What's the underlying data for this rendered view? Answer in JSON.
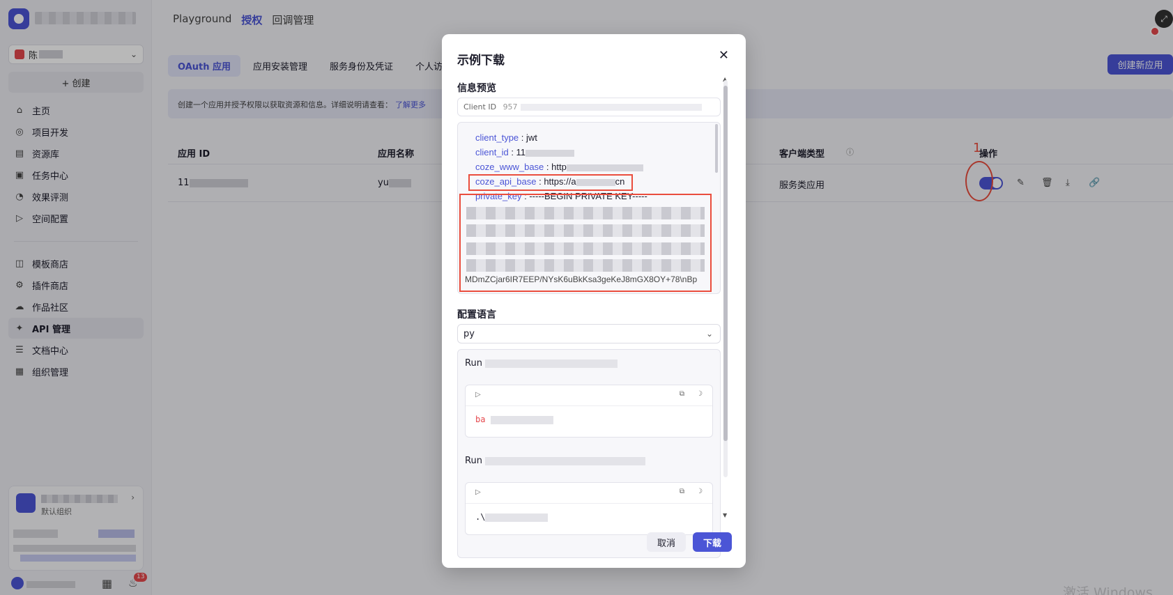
{
  "sidebar": {
    "space_name": "陈",
    "create_label": "+ 创建",
    "items": [
      {
        "icon": "home-icon",
        "glyph": "⌂",
        "label": "主页"
      },
      {
        "icon": "gamepad-icon",
        "glyph": "◎",
        "label": "项目开发"
      },
      {
        "icon": "library-icon",
        "glyph": "▤",
        "label": "资源库"
      },
      {
        "icon": "task-icon",
        "glyph": "▣",
        "label": "任务中心"
      },
      {
        "icon": "gauge-icon",
        "glyph": "◔",
        "label": "效果评测"
      },
      {
        "icon": "terminal-icon",
        "glyph": "▷",
        "label": "空间配置"
      }
    ],
    "items2": [
      {
        "icon": "template-icon",
        "glyph": "◫",
        "label": "模板商店"
      },
      {
        "icon": "plugin-icon",
        "glyph": "⚙",
        "label": "插件商店"
      },
      {
        "icon": "community-icon",
        "glyph": "☁",
        "label": "作品社区"
      },
      {
        "icon": "api-icon",
        "glyph": "✦",
        "label": "API 管理"
      },
      {
        "icon": "doc-icon",
        "glyph": "☰",
        "label": "文档中心"
      },
      {
        "icon": "org-icon",
        "glyph": "▦",
        "label": "组织管理"
      }
    ],
    "org_sub": "默认组织",
    "notification_count": "13"
  },
  "header": {
    "tabs": [
      "Playground",
      "授权",
      "回调管理"
    ],
    "active_tab": 1
  },
  "subtabs": [
    "OAuth 应用",
    "应用安装管理",
    "服务身份及凭证",
    "个人访"
  ],
  "create_app_label": "创建新应用",
  "info_text": "创建一个应用并授予权限以获取资源和信息。详细说明请查看：",
  "info_link": "了解更多",
  "table": {
    "headers": {
      "app_id": "应用 ID",
      "app_name": "应用名称",
      "client_type": "客户端类型",
      "ops": "操作"
    },
    "row": {
      "app_id": "11",
      "app_name": "yu",
      "client_type": "服务类应用"
    }
  },
  "annotation_label": "1",
  "modal": {
    "title": "示例下载",
    "info_preview_label": "信息预览",
    "client_id_label": "Client ID",
    "client_id_value": "957",
    "fields": [
      {
        "key": "client_type",
        "value": "jwt"
      },
      {
        "key": "client_id",
        "value": "11"
      },
      {
        "key": "coze_www_base",
        "value": "http"
      },
      {
        "key": "coze_api_base",
        "value": "https://a"
      },
      {
        "key": "private_key",
        "value": "-----BEGIN PRIVATE KEY-----"
      }
    ],
    "api_base_suffix": "cn",
    "pk_visible_line": "MDmZCjar6IR7EEP/NYsK6uBkKsa3geKeJ8mGX8OY+78\\nBp",
    "config_lang_label": "配置语言",
    "lang_value": "py",
    "run_label": "Run",
    "code1_prefix": "ba",
    "code2_prefix": ".\\",
    "cancel_label": "取消",
    "download_label": "下载"
  },
  "watermark": "激活 Windows"
}
